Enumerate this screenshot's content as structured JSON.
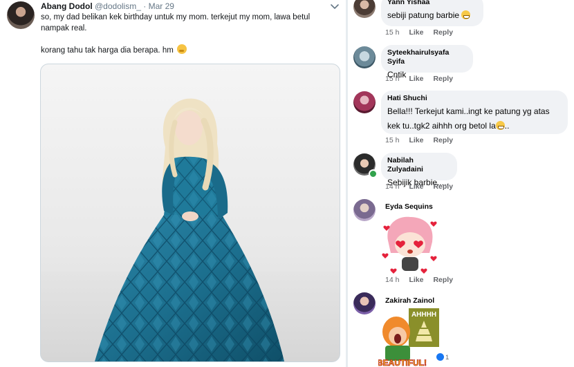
{
  "tweet": {
    "author_name": "Abang Dodol",
    "handle": "@dodolism_",
    "separator": "·",
    "date": "Mar 29",
    "line1": "so, my dad belikan kek birthday untuk my mom. terkejut my mom, lawa betul nampak real.",
    "line2": "korang tahu tak harga dia berapa. hm",
    "line2_emoji": "thinking-face-icon",
    "dress_color": "#1c6f8e"
  },
  "comments": [
    {
      "name": "Yann Yishaa",
      "text": "sebiji patung barbie",
      "time": "15 h",
      "like": "Like",
      "reply": "Reply"
    },
    {
      "name": "Syteekhairulsyafa Syifa",
      "text": "Cntik",
      "time": "15 h",
      "like": "Like",
      "reply": "Reply"
    },
    {
      "name": "Hati Shuchi",
      "text_line1": "Bella!!! Terkejut kami..ingt ke patung yg atas",
      "text_line2": "kek tu..tgk2 aihhh org betol la",
      "text_line2_end": "..",
      "time": "15 h",
      "like": "Like",
      "reply": "Reply"
    },
    {
      "name": "Nabilah Zulyadaini",
      "text": "Sebijik barbie.....",
      "time": "14 h",
      "like": "Like",
      "reply": "Reply"
    },
    {
      "name": "Eyda Sequins",
      "time": "14 h",
      "like": "Like",
      "reply": "Reply"
    },
    {
      "name": "Zakirah Zainol",
      "sticker_text_top": "AHHHH",
      "sticker_text_bottom": "BEAUTIFUL!",
      "reaction_count": "1"
    }
  ]
}
